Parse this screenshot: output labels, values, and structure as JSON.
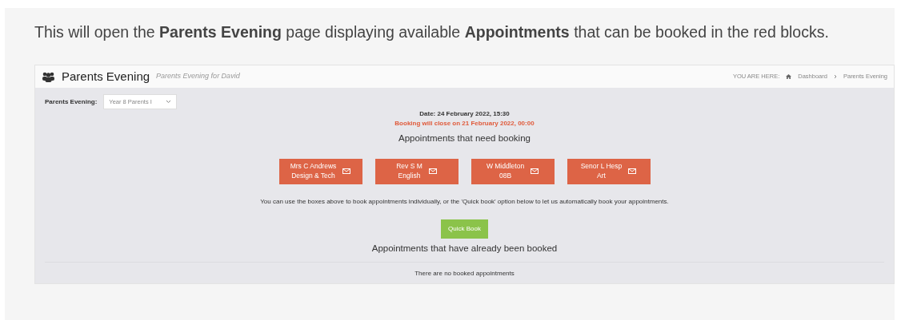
{
  "caption": "This will open the **Parents Evening** page displaying available **Appointments** that can be booked in the red blocks.",
  "header": {
    "title": "Parents Evening",
    "subtitle": "Parents Evening for David",
    "breadcrumb_label": "YOU ARE HERE:",
    "breadcrumbs": [
      "Dashboard",
      "Parents Evening"
    ]
  },
  "selector": {
    "label": "Parents Evening:",
    "value": "Year 8 Parents I"
  },
  "date": "Date: 24 February 2022, 15:30",
  "closing_notice": "Booking will close on 21 February 2022, 00:00",
  "need_booking_heading": "Appointments that need booking",
  "appointments": [
    {
      "teacher": "Mrs C Andrews",
      "subject": "Design & Tech"
    },
    {
      "teacher": "Rev S M",
      "subject": "English"
    },
    {
      "teacher": "W Middleton",
      "subject": "08B"
    },
    {
      "teacher": "Senor L Hesp",
      "subject": "Art"
    }
  ],
  "instructions": "You can use the boxes above to book appointments individually, or the 'Quick book' option below to let us automatically book your appointments.",
  "quick_book_button": "Quick Book",
  "booked_heading": "Appointments that have already been booked",
  "booked_empty": "There are no booked appointments"
}
